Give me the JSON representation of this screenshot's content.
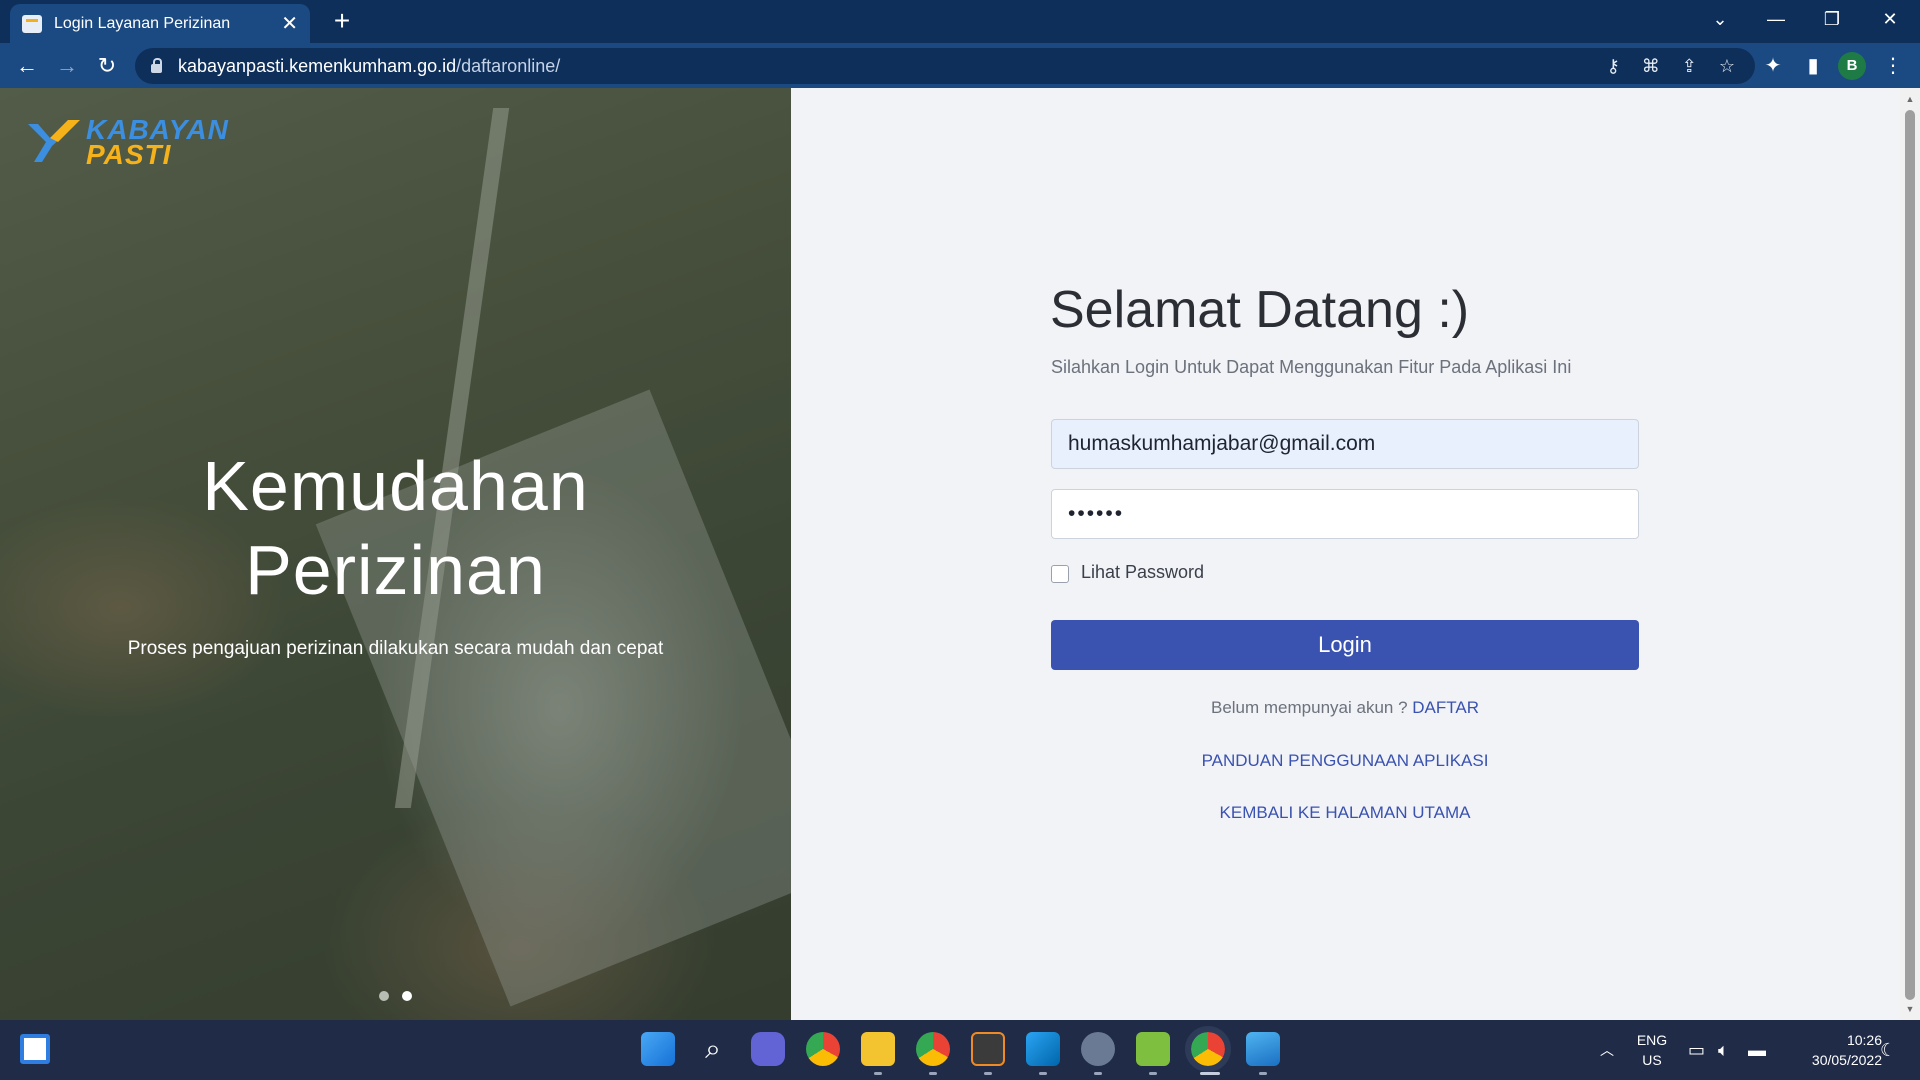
{
  "browser": {
    "tab_title": "Login Layanan Perizinan",
    "url_domain": "kabayanpasti.kemenkumham.go.id",
    "url_path": "/daftaronline/",
    "profile_initial": "B"
  },
  "hero": {
    "logo_line1": "KABAYAN",
    "logo_line2": "PASTI",
    "title_line1": "Kemudahan",
    "title_line2": "Perizinan",
    "subtitle": "Proses pengajuan perizinan dilakukan secara mudah dan cepat"
  },
  "login": {
    "welcome": "Selamat Datang :)",
    "instruction": "Silahkan Login Untuk Dapat Menggunakan Fitur Pada Aplikasi Ini",
    "email_value": "humaskumhamjabar@gmail.com",
    "password_value": "••••••",
    "show_password_label": "Lihat Password",
    "login_button": "Login",
    "no_account_text": "Belum mempunyai akun ? ",
    "register_link": "DAFTAR",
    "guide_link": "PANDUAN PENGGUNAAN APLIKASI",
    "home_link": "KEMBALI KE HALAMAN UTAMA"
  },
  "taskbar": {
    "lang_line1": "ENG",
    "lang_line2": "US",
    "time": "10:26",
    "date": "30/05/2022"
  },
  "colors": {
    "primary": "#3a52b0",
    "chrome_dark": "#0e2f5a",
    "chrome": "#1b4a82",
    "taskbar": "#1f2b47",
    "logo_blue": "#3c8ee0",
    "logo_yellow": "#f5b21a"
  }
}
